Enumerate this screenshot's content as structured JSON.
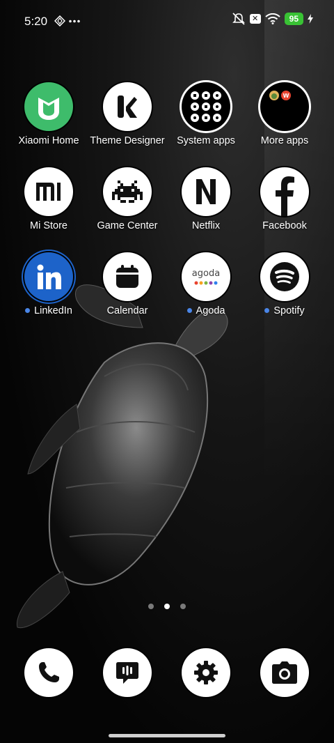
{
  "status_bar": {
    "time": "5:20",
    "battery": "95",
    "icons_left": [
      "data-saver-icon",
      "more-dots-icon"
    ],
    "icons_right": [
      "silent-icon",
      "x-badge-icon",
      "wifi-icon",
      "battery-icon",
      "charging-icon"
    ]
  },
  "apps": [
    {
      "label": "Xiaomi Home",
      "icon": "xiaomi-home-icon",
      "accent": "#3ebc6b"
    },
    {
      "label": "Theme Designer",
      "icon": "theme-designer-icon"
    },
    {
      "label": "System apps",
      "icon": "folder-grid-icon"
    },
    {
      "label": "More apps",
      "icon": "folder-icon"
    },
    {
      "label": "Mi Store",
      "icon": "mi-store-icon"
    },
    {
      "label": "Game Center",
      "icon": "game-center-icon"
    },
    {
      "label": "Netflix",
      "icon": "netflix-icon"
    },
    {
      "label": "Facebook",
      "icon": "facebook-icon"
    },
    {
      "label": "LinkedIn",
      "icon": "linkedin-icon",
      "accent": "#1d63c9",
      "new_dot": true
    },
    {
      "label": "Calendar",
      "icon": "calendar-icon"
    },
    {
      "label": "Agoda",
      "icon": "agoda-icon",
      "icon_text": "agoda",
      "new_dot": true
    },
    {
      "label": "Spotify",
      "icon": "spotify-icon",
      "new_dot": true
    }
  ],
  "pager": {
    "pages": 3,
    "active_page": 2
  },
  "dock": [
    "phone-icon",
    "messages-icon",
    "settings-icon",
    "camera-icon"
  ],
  "colors": {
    "notification_dot": "#4a86e8",
    "battery": "#39c234"
  }
}
